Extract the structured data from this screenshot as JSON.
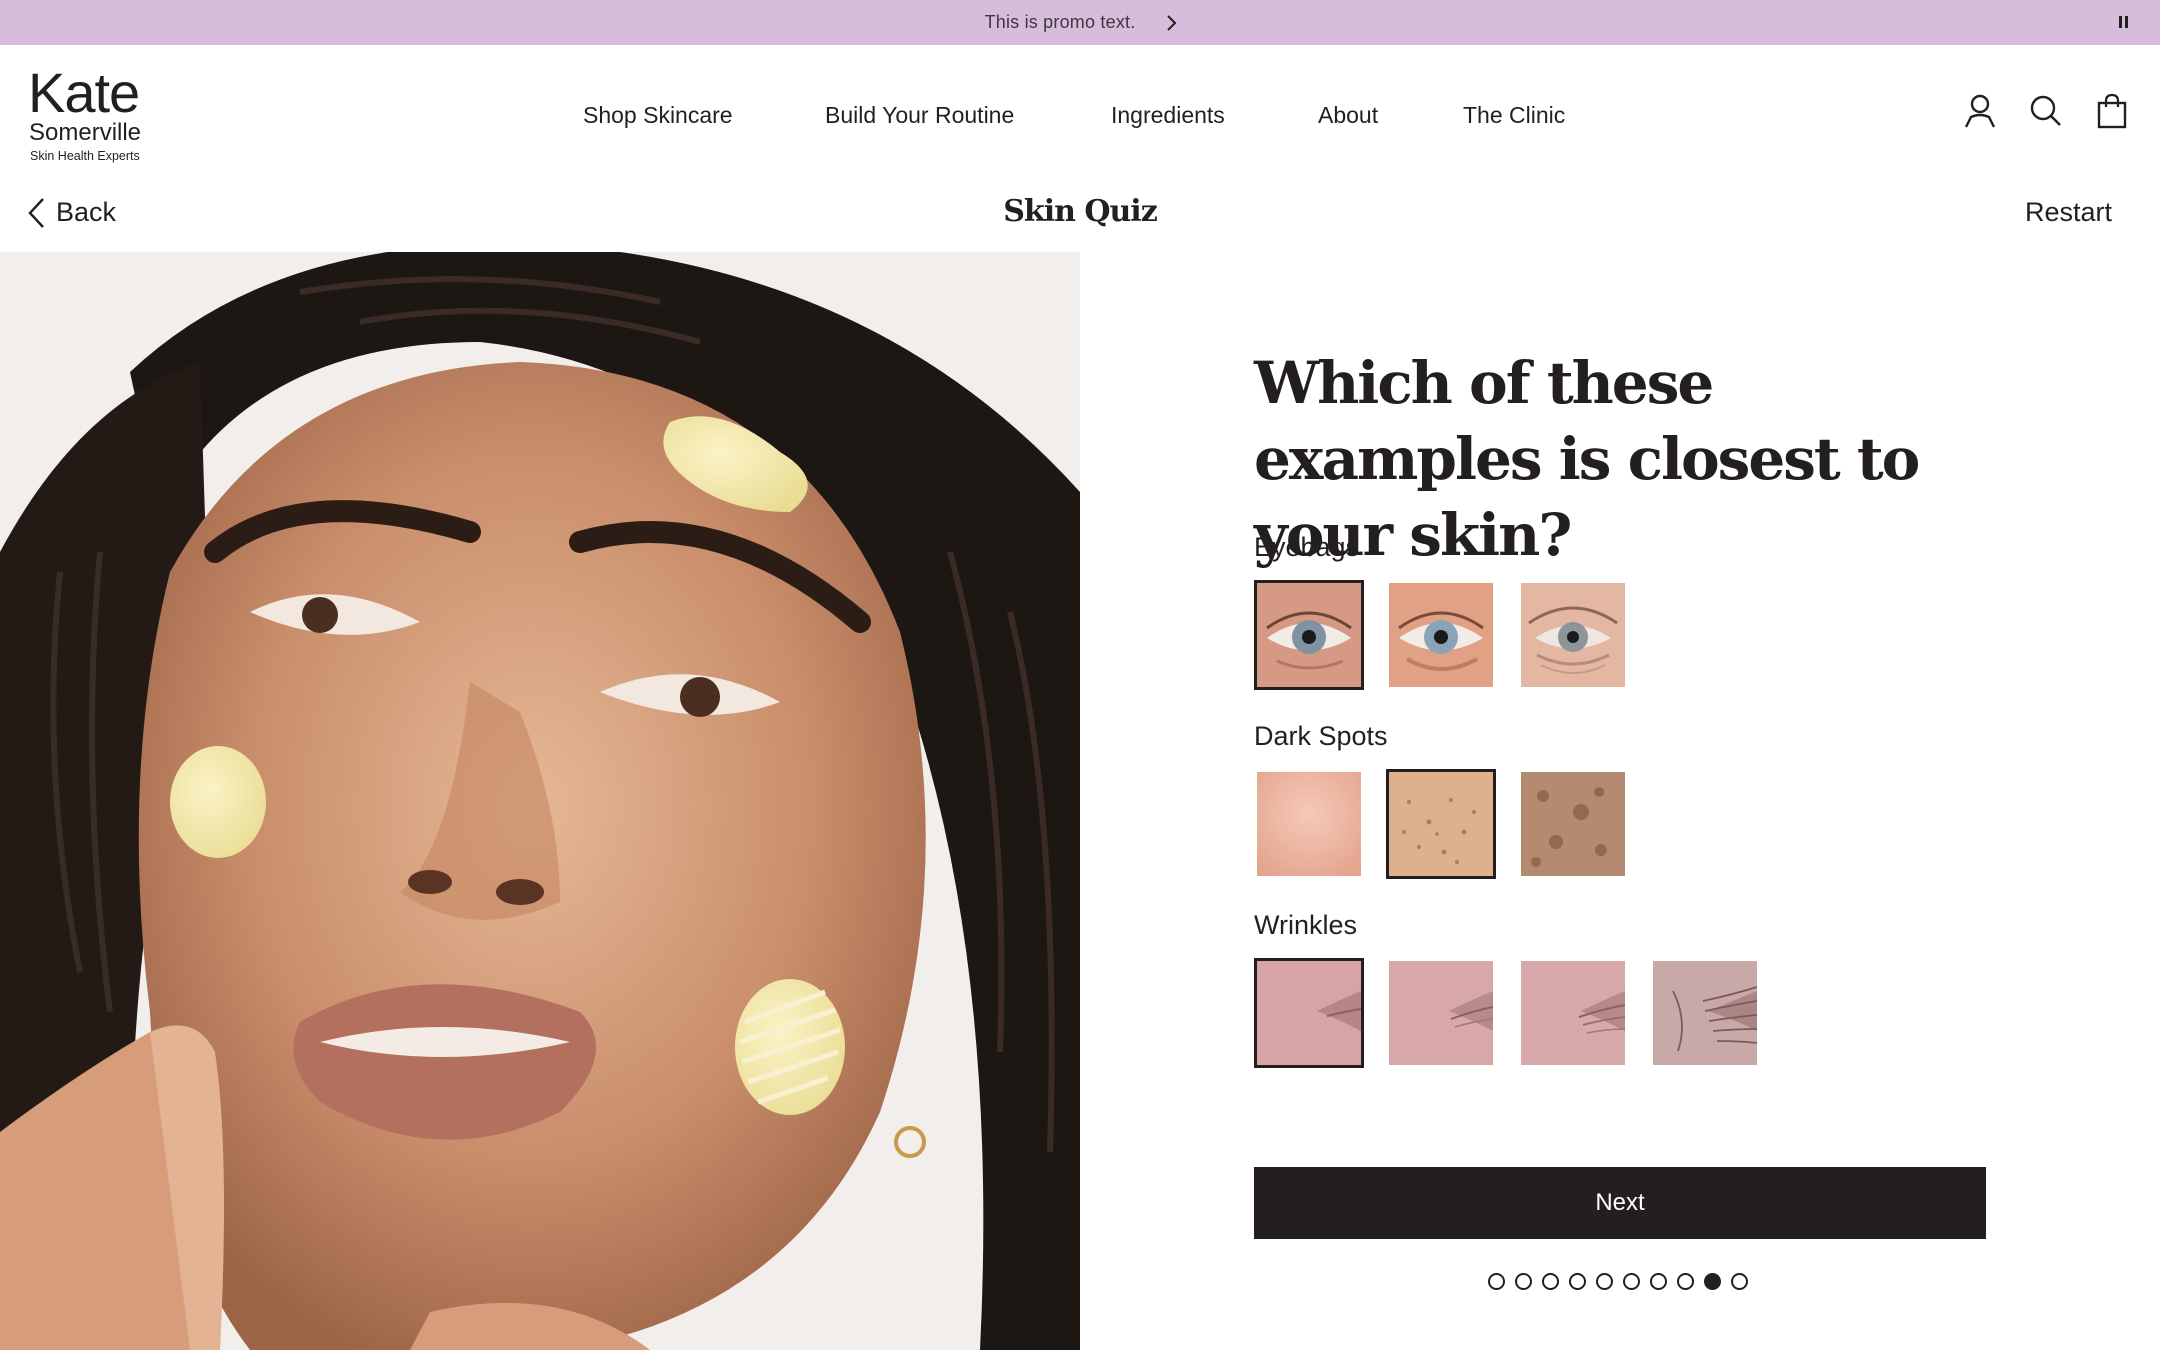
{
  "colors": {
    "promo_bg": "#d7bcdc",
    "text": "#231f20",
    "button_bg": "#231f20",
    "button_text": "#ffffff"
  },
  "promo": {
    "text": "This is promo text.",
    "next_icon": "chevron-right-icon",
    "pause_icon": "pause-icon"
  },
  "logo": {
    "line1": "Kate",
    "line2": "Somerville",
    "tagline": "Skin Health Experts"
  },
  "nav": {
    "items": [
      {
        "label": "Shop Skincare"
      },
      {
        "label": "Build Your Routine"
      },
      {
        "label": "Ingredients"
      },
      {
        "label": "About"
      },
      {
        "label": "The Clinic"
      }
    ]
  },
  "header_icons": [
    "account-icon",
    "search-icon",
    "shopping-bag-icon"
  ],
  "quizbar": {
    "back_label": "Back",
    "title": "Skin Quiz",
    "restart_label": "Restart"
  },
  "question": {
    "text": "Which of these examples  is closest to your skin?"
  },
  "categories": [
    {
      "label": "Eyebags",
      "options": 3,
      "selected_index": 0
    },
    {
      "label": "Dark Spots",
      "options": 3,
      "selected_index": 1
    },
    {
      "label": "Wrinkles",
      "options": 4,
      "selected_index": 0
    }
  ],
  "next_button": {
    "label": "Next"
  },
  "progress": {
    "total_steps": 10,
    "current_step": 9
  }
}
